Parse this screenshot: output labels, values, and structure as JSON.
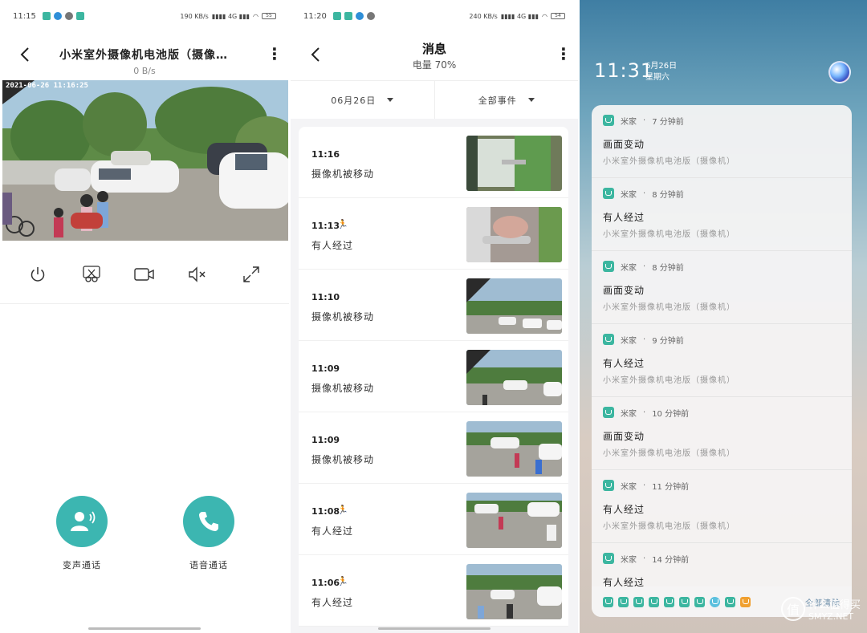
{
  "panel1": {
    "status": {
      "time": "11:15",
      "net_speed": "190 KB/s",
      "battery": "55"
    },
    "title": "小米室外摄像机电池版（摄像…",
    "subtitle": "0 B/s",
    "video_timestamp": "2021-06-26 11:16:25",
    "controls": [
      "power-icon",
      "scissors-icon",
      "record-icon",
      "mute-icon",
      "fullscreen-icon"
    ],
    "calls": [
      {
        "label": "变声通话",
        "icon": "voice-change-icon"
      },
      {
        "label": "语音通话",
        "icon": "phone-icon"
      }
    ],
    "accent": "#3cb6b1"
  },
  "panel2": {
    "status": {
      "time": "11:20",
      "net_speed": "240 KB/s",
      "battery": "54"
    },
    "title": "消息",
    "subtitle": "电量 70%",
    "date_filter": "06月26日",
    "event_filter": "全部事件",
    "events": [
      {
        "time": "11:16",
        "label": "摄像机被移动",
        "person": false
      },
      {
        "time": "11:13",
        "label": "有人经过",
        "person": true
      },
      {
        "time": "11:10",
        "label": "摄像机被移动",
        "person": false
      },
      {
        "time": "11:09",
        "label": "摄像机被移动",
        "person": false
      },
      {
        "time": "11:09",
        "label": "摄像机被移动",
        "person": false
      },
      {
        "time": "11:08",
        "label": "有人经过",
        "person": true
      },
      {
        "time": "11:06",
        "label": "有人经过",
        "person": true
      }
    ]
  },
  "panel3": {
    "time": "11:31",
    "date": "6月26日",
    "weekday": "星期六",
    "notifications": [
      {
        "app": "米家",
        "ago": "7 分钟前",
        "title": "画面变动",
        "body": "小米室外摄像机电池版（摄像机）"
      },
      {
        "app": "米家",
        "ago": "8 分钟前",
        "title": "有人经过",
        "body": "小米室外摄像机电池版（摄像机）"
      },
      {
        "app": "米家",
        "ago": "8 分钟前",
        "title": "画面变动",
        "body": "小米室外摄像机电池版（摄像机）"
      },
      {
        "app": "米家",
        "ago": "9 分钟前",
        "title": "有人经过",
        "body": "小米室外摄像机电池版（摄像机）"
      },
      {
        "app": "米家",
        "ago": "10 分钟前",
        "title": "画面变动",
        "body": "小米室外摄像机电池版（摄像机）"
      },
      {
        "app": "米家",
        "ago": "11 分钟前",
        "title": "有人经过",
        "body": "小米室外摄像机电池版（摄像机）"
      },
      {
        "app": "米家",
        "ago": "14 分钟前",
        "title": "有人经过",
        "body": ""
      }
    ],
    "clear_label": "全部清除",
    "watermark": "什么值得买",
    "watermark_sub": "SMYZ.NET"
  }
}
